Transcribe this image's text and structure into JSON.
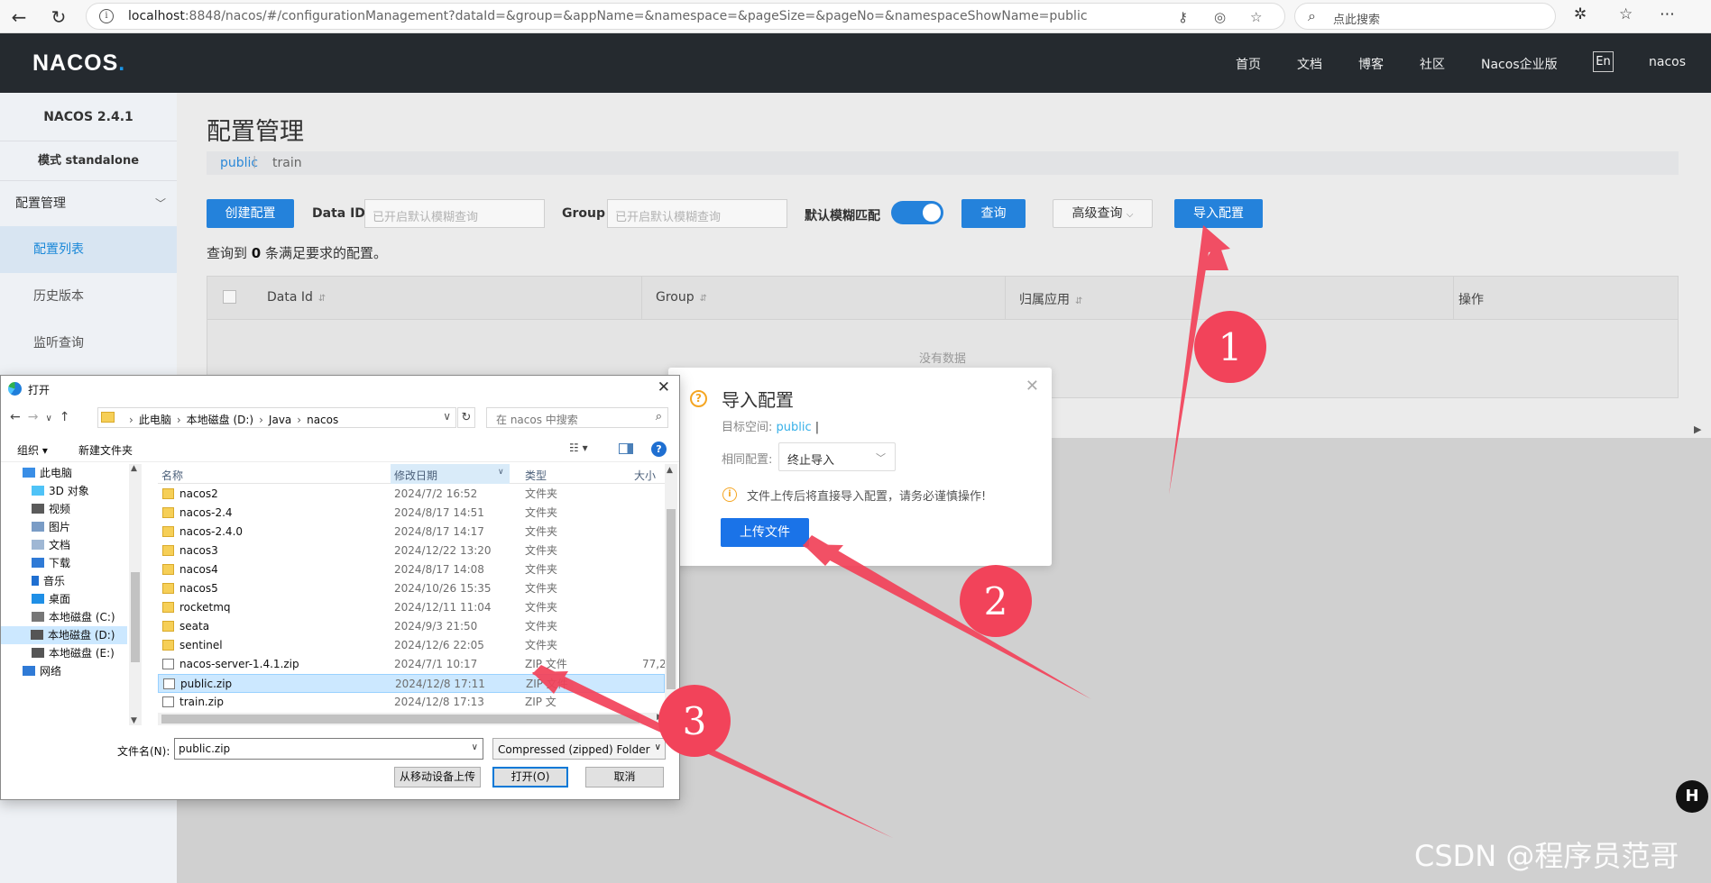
{
  "browser": {
    "url_host": "localhost",
    "url_rest": ":8848/nacos/#/configurationManagement?dataId=&group=&appName=&namespace=&pageSize=&pageNo=&namespaceShowName=public",
    "search_placeholder": "点此搜索"
  },
  "header": {
    "logo": "NACOS.",
    "nav": [
      "首页",
      "文档",
      "博客",
      "社区",
      "Nacos企业版"
    ],
    "lang": "En",
    "user": "nacos"
  },
  "sidebar": {
    "version": "NACOS 2.4.1",
    "mode": "模式 standalone",
    "group": "配置管理",
    "items": [
      "配置列表",
      "历史版本",
      "监听查询"
    ]
  },
  "main": {
    "title": "配置管理",
    "namespaces": [
      "public",
      "train"
    ],
    "create_button": "创建配置",
    "data_id_label": "Data ID",
    "data_id_placeholder": "已开启默认模糊查询",
    "group_label": "Group",
    "group_placeholder": "已开启默认模糊查询",
    "fuzzy_label": "默认模糊匹配",
    "query_button": "查询",
    "advanced_button": "高级查询",
    "import_button": "导入配置",
    "result_prefix": "查询到",
    "result_count": "0",
    "result_suffix": "条满足要求的配置。",
    "table": {
      "columns": [
        "Data Id",
        "Group",
        "归属应用",
        "操作"
      ],
      "empty": "没有数据"
    }
  },
  "import_dialog": {
    "title": "导入配置",
    "target_label": "目标空间:",
    "target_value": "public",
    "target_cursor": "|",
    "same_label": "相同配置:",
    "same_value": "终止导入",
    "note": "文件上传后将直接导入配置，请务必谨慎操作!",
    "upload_button": "上传文件"
  },
  "open_dialog": {
    "title": "打开",
    "path": [
      "此电脑",
      "本地磁盘 (D:)",
      "Java",
      "nacos"
    ],
    "search_placeholder": "在 nacos 中搜索",
    "organize": "组织 ▾",
    "new_folder": "新建文件夹",
    "tree": [
      {
        "label": "此电脑",
        "icon": "pc-icon"
      },
      {
        "label": "3D 对象",
        "icon": "cube-icon"
      },
      {
        "label": "视频",
        "icon": "video-icon"
      },
      {
        "label": "图片",
        "icon": "image-icon"
      },
      {
        "label": "文档",
        "icon": "document-icon"
      },
      {
        "label": "下载",
        "icon": "download-icon"
      },
      {
        "label": "音乐",
        "icon": "music-icon"
      },
      {
        "label": "桌面",
        "icon": "desktop-icon"
      },
      {
        "label": "本地磁盘 (C:)",
        "icon": "drive-icon"
      },
      {
        "label": "本地磁盘 (D:)",
        "icon": "drive-icon"
      },
      {
        "label": "本地磁盘 (E:)",
        "icon": "drive-icon"
      },
      {
        "label": "网络",
        "icon": "network-icon"
      }
    ],
    "columns": [
      "名称",
      "修改日期",
      "类型",
      "大小"
    ],
    "files": [
      {
        "name": "nacos2",
        "date": "2024/7/2 16:52",
        "type": "文件夹",
        "size": "",
        "kind": "folder"
      },
      {
        "name": "nacos-2.4",
        "date": "2024/8/17 14:51",
        "type": "文件夹",
        "size": "",
        "kind": "folder"
      },
      {
        "name": "nacos-2.4.0",
        "date": "2024/8/17 14:17",
        "type": "文件夹",
        "size": "",
        "kind": "folder"
      },
      {
        "name": "nacos3",
        "date": "2024/12/22 13:20",
        "type": "文件夹",
        "size": "",
        "kind": "folder"
      },
      {
        "name": "nacos4",
        "date": "2024/8/17 14:08",
        "type": "文件夹",
        "size": "",
        "kind": "folder"
      },
      {
        "name": "nacos5",
        "date": "2024/10/26 15:35",
        "type": "文件夹",
        "size": "",
        "kind": "folder"
      },
      {
        "name": "rocketmq",
        "date": "2024/12/11 11:04",
        "type": "文件夹",
        "size": "",
        "kind": "folder"
      },
      {
        "name": "seata",
        "date": "2024/9/3 21:50",
        "type": "文件夹",
        "size": "",
        "kind": "folder"
      },
      {
        "name": "sentinel",
        "date": "2024/12/6 22:05",
        "type": "文件夹",
        "size": "",
        "kind": "folder"
      },
      {
        "name": "nacos-server-1.4.1.zip",
        "date": "2024/7/1 10:17",
        "type": "ZIP 文件",
        "size": "77,2",
        "kind": "zip"
      },
      {
        "name": "public.zip",
        "date": "2024/12/8 17:11",
        "type": "ZIP 文件",
        "size": "",
        "kind": "zip"
      },
      {
        "name": "train.zip",
        "date": "2024/12/8 17:13",
        "type": "ZIP 文",
        "size": "",
        "kind": "zip"
      }
    ],
    "filename_label": "文件名(N):",
    "filename_value": "public.zip",
    "filetype_value": "Compressed (zipped) Folder",
    "mobile_button": "从移动设备上传",
    "open_button": "打开(O)",
    "cancel_button": "取消"
  },
  "annotations": [
    "1",
    "2",
    "3"
  ],
  "watermark": "CSDN @程序员范哥",
  "colors": {
    "accent": "#2482db",
    "header": "#252a2f",
    "arrow": "#f2435a"
  }
}
